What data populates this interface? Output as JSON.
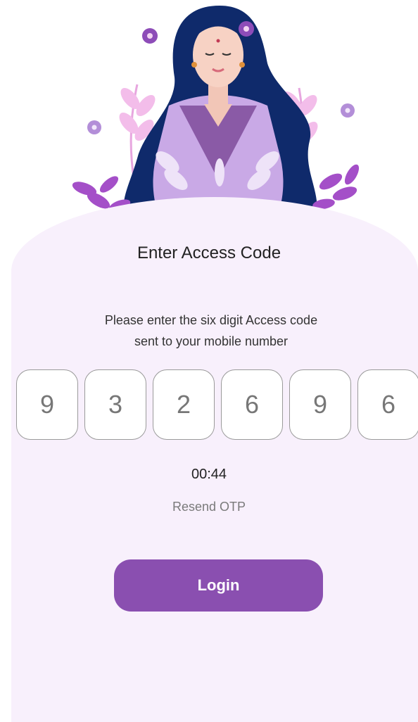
{
  "screen": {
    "title": "Enter Access Code",
    "subtitle": "Please enter the six digit Access code sent to your mobile number"
  },
  "otp": {
    "digits": [
      "9",
      "3",
      "2",
      "6",
      "9",
      "6"
    ]
  },
  "timer": "00:44",
  "resend_label": "Resend OTP",
  "login_label": "Login",
  "illustration": {
    "icon": "woman-with-flowers-illustration"
  },
  "colors": {
    "accent": "#8a4fb0",
    "card_background": "#f8f0fc",
    "hair": "#0f2a6b",
    "flower": "#9b4fc2",
    "leaf": "#d58ad8"
  }
}
